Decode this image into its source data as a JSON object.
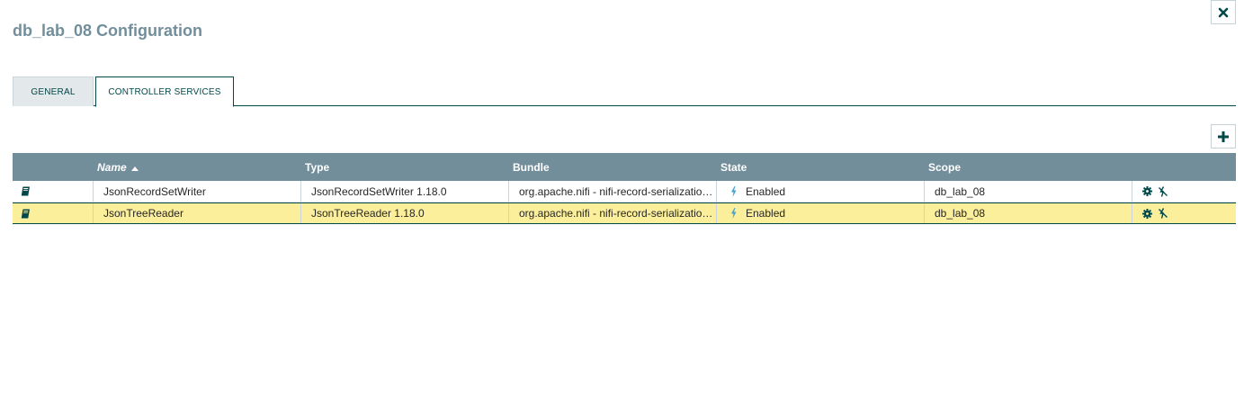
{
  "dialog": {
    "title": "db_lab_08 Configuration"
  },
  "tabs": [
    {
      "label": "GENERAL",
      "active": false
    },
    {
      "label": "CONTROLLER SERVICES",
      "active": true
    }
  ],
  "table": {
    "columns": {
      "name": "Name",
      "type": "Type",
      "bundle": "Bundle",
      "state": "State",
      "scope": "Scope"
    },
    "sort": {
      "column": "Name",
      "direction": "ascending"
    },
    "rows": [
      {
        "name": "JsonRecordSetWriter",
        "type": "JsonRecordSetWriter 1.18.0",
        "bundle": "org.apache.nifi - nifi-record-serialization…",
        "state": "Enabled",
        "scope": "db_lab_08",
        "selected": false
      },
      {
        "name": "JsonTreeReader",
        "type": "JsonTreeReader 1.18.0",
        "bundle": "org.apache.nifi - nifi-record-serialization…",
        "state": "Enabled",
        "scope": "db_lab_08",
        "selected": true
      }
    ]
  },
  "icons": {
    "close": "close-icon",
    "add": "plus-icon",
    "row_type": "book-icon",
    "state": "lightning-bolt-icon",
    "configure": "gear-icon",
    "disable": "disable-icon",
    "sort": "sort-ascending-icon"
  },
  "colors": {
    "title": "#728e9b",
    "header_bg": "#728e9b",
    "accent": "#004849",
    "selected_row": "#fcef9b",
    "enabled_bolt": "#44a3cf"
  }
}
